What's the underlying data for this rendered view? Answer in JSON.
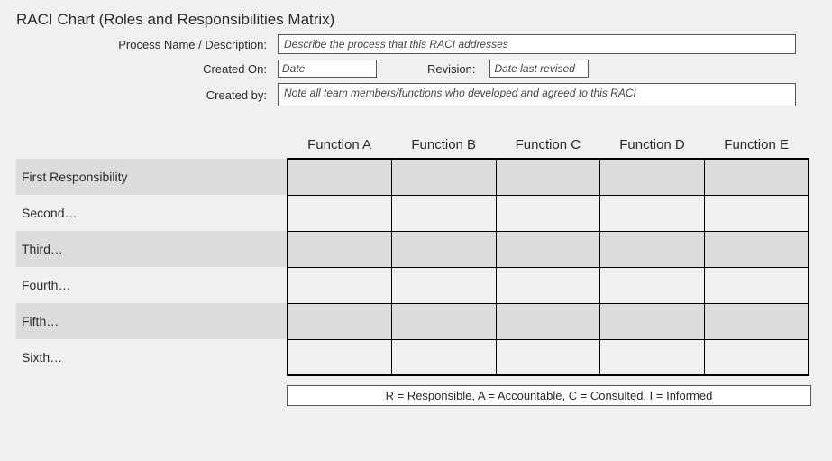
{
  "title": "RACI Chart (Roles and Responsibilities Matrix)",
  "meta": {
    "process_label": "Process Name / Description:",
    "process_placeholder": "Describe the process that this RACI addresses",
    "created_on_label": "Created On:",
    "created_on_placeholder": "Date",
    "revision_label": "Revision:",
    "revision_placeholder": "Date last revised",
    "created_by_label": "Created by:",
    "created_by_placeholder": "Note all team members/functions who developed and agreed to this RACI"
  },
  "chart_data": {
    "type": "table",
    "title": "RACI Chart (Roles and Responsibilities Matrix)",
    "columns": [
      "Function A",
      "Function B",
      "Function C",
      "Function D",
      "Function E"
    ],
    "rows": [
      "First Responsibility",
      "Second…",
      "Third…",
      "Fourth…",
      "Fifth…",
      "Sixth…"
    ],
    "cells": [
      [
        "",
        "",
        "",
        "",
        ""
      ],
      [
        "",
        "",
        "",
        "",
        ""
      ],
      [
        "",
        "",
        "",
        "",
        ""
      ],
      [
        "",
        "",
        "",
        "",
        ""
      ],
      [
        "",
        "",
        "",
        "",
        ""
      ],
      [
        "",
        "",
        "",
        "",
        ""
      ]
    ],
    "legend": "R = Responsible, A = Accountable, C = Consulted, I = Informed"
  }
}
